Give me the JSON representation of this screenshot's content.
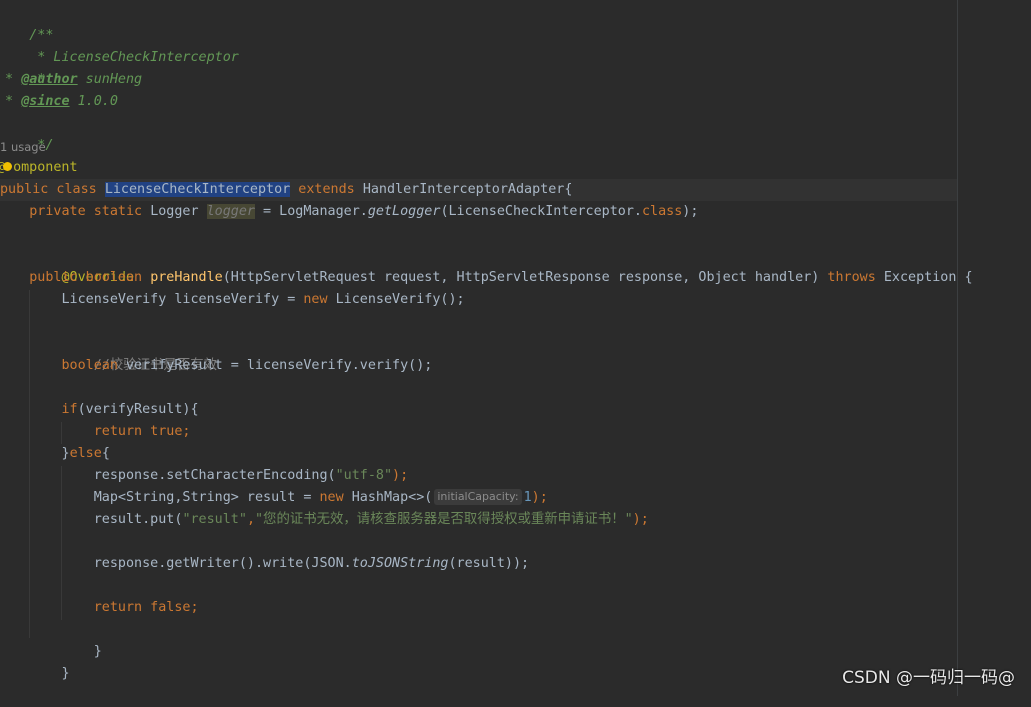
{
  "editor": {
    "doc": {
      "open": "/**",
      "title_line": " * LicenseCheckInterceptor",
      "blank_line": " *",
      "author_prefix": " * ",
      "author_tag": "@author",
      "author_value": " sunHeng",
      "since_prefix": " * ",
      "since_tag": "@since",
      "since_value": " 1.0.0",
      "close": " */"
    },
    "usage_hint": "1 usage",
    "annotation_component_at": "@",
    "annotation_component_rest": "omponent",
    "class_decl": {
      "kw": "public class ",
      "name": "LicenseCheckInterceptor",
      "extends_kw": " extends ",
      "parent": "HandlerInterceptorAdapter{"
    },
    "logger_line": {
      "indent": "    ",
      "kw": "private static ",
      "type": "Logger ",
      "name": "logger",
      "assign": " = LogManager.",
      "method": "getLogger",
      "arg": "(LicenseCheckInterceptor.",
      "class_kw": "class",
      "end": ");"
    },
    "override": "    @Override",
    "method_decl": {
      "indent": "    ",
      "kw": "public boolean ",
      "name": "preHandle",
      "params": "(HttpServletRequest request, HttpServletResponse response, Object handler) ",
      "throws_kw": "throws",
      "rest": " Exception {"
    },
    "verify_decl": {
      "indent": "        ",
      "lhs": "LicenseVerify licenseVerify = ",
      "new_kw": "new",
      "rhs": " LicenseVerify();"
    },
    "comment": "        //校验证书是否有效",
    "result_decl": {
      "indent": "        ",
      "kw": "boolean",
      "rest": " verifyResult = licenseVerify.verify();"
    },
    "if_line": {
      "indent": "        ",
      "kw": "if",
      "rest": "(verifyResult){"
    },
    "return_true": {
      "indent": "            ",
      "kw": "return true;"
    },
    "else_line": {
      "indent": "        ",
      "brace": "}",
      "kw": "else",
      "rest": "{"
    },
    "encoding_line": {
      "indent": "            ",
      "code": "response.setCharacterEncoding(",
      "str": "\"utf-8\"",
      "end": ");"
    },
    "map_line": {
      "indent": "            ",
      "code": "Map<String,String> result = ",
      "new_kw": "new",
      "code2": " HashMap<>(",
      "hint": "initialCapacity:",
      "num": "1",
      "end": ");"
    },
    "put_line": {
      "indent": "            ",
      "code": "result.put(",
      "key": "\"result\"",
      "comma": ",",
      "value": "\"您的证书无效，请核查服务器是否取得授权或重新申请证书！\"",
      "end": ");"
    },
    "write_line": {
      "indent": "            ",
      "code": "response.getWriter().write(JSON.",
      "method": "toJSONString",
      "end": "(result));"
    },
    "return_false": {
      "indent": "            ",
      "kw": "return false;"
    },
    "close_else": "        }",
    "close_method": "    }"
  },
  "watermark": "CSDN @一码归一码@",
  "colors": {
    "background": "#2b2b2b",
    "keyword": "#cc7832",
    "string": "#6a8759",
    "doc_comment": "#629755",
    "method": "#ffc66d",
    "annotation": "#bbb529",
    "selection": "#214283"
  }
}
